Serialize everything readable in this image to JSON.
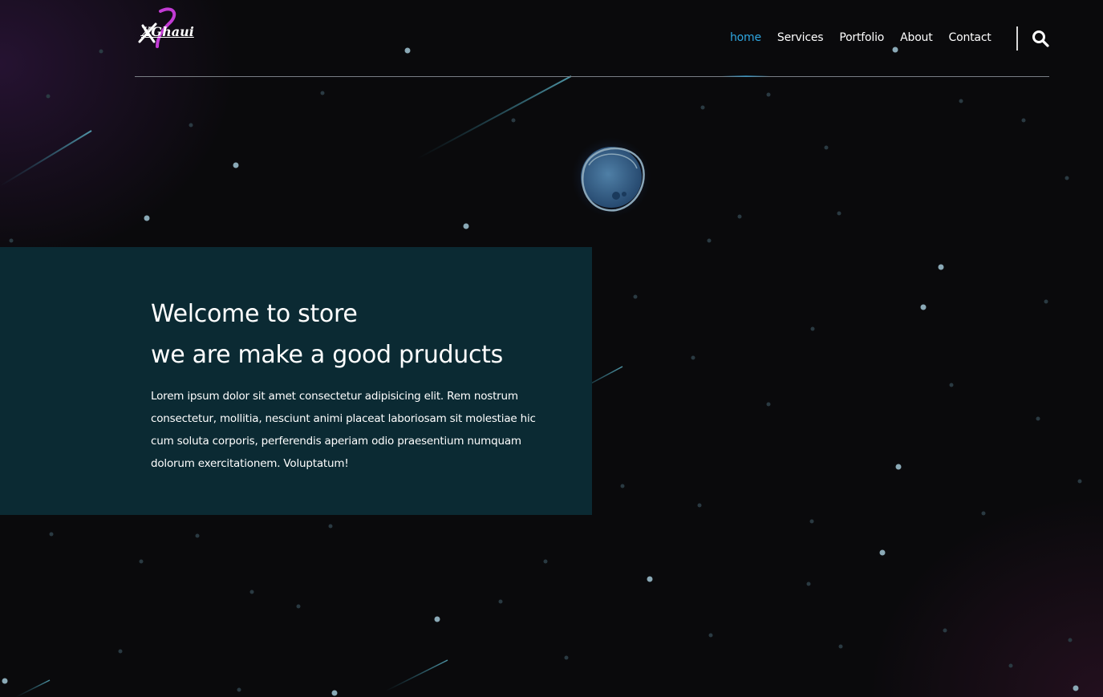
{
  "brand": {
    "logo_text": "XGhaui",
    "accent_color": "#c23bd4"
  },
  "nav": {
    "items": [
      {
        "label": "home",
        "active": true
      },
      {
        "label": "Services",
        "active": false
      },
      {
        "label": "Portfolio",
        "active": false
      },
      {
        "label": "About",
        "active": false
      },
      {
        "label": "Contact",
        "active": false
      }
    ],
    "search_icon": "search-icon",
    "active_color": "#2ea6e0"
  },
  "hero": {
    "title_line1": "Welcome to store",
    "title_line2": "we are make a good pruducts",
    "body": "Lorem ipsum dolor sit amet consectetur adipisicing elit. Rem nostrum consectetur, mollitia, nesciunt animi placeat laboriosam sit molestiae hic cum soluta corporis, perferendis aperiam odio praesentium numquam dolorum exercitationem. Voluptatum!",
    "panel_color": "#0b2a33"
  },
  "theme": {
    "background": "#0a0a0c",
    "star_color": "#8fb4c2"
  }
}
